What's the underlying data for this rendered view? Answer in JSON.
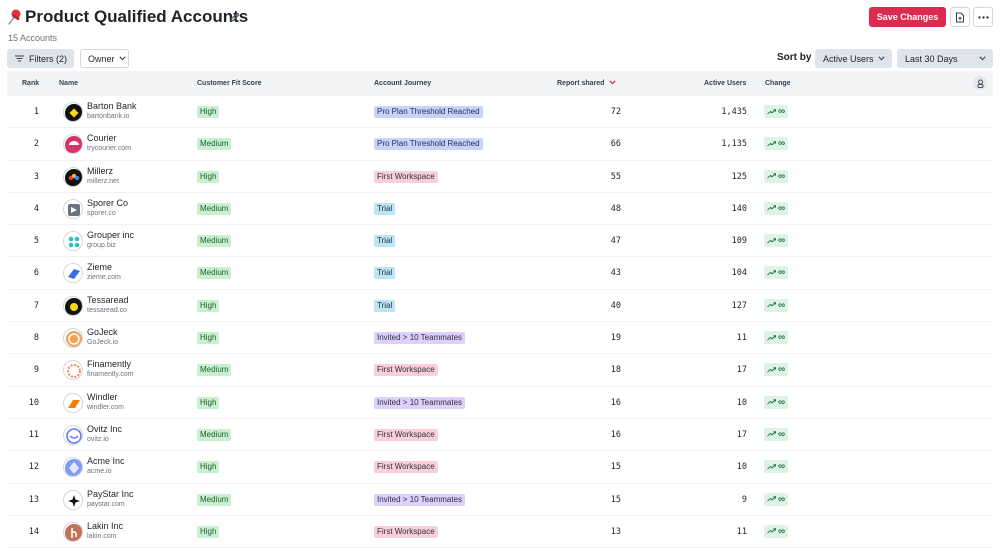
{
  "header": {
    "title": "Product Qualified Accounts",
    "subtitle": "15 Accounts",
    "save_label": "Save Changes"
  },
  "toolbar": {
    "filters_label": "Filters (2)",
    "owner_label": "Owner",
    "sortby_label": "Sort by",
    "sort_field": "Active Users",
    "date_range": "Last 30 Days"
  },
  "table": {
    "columns": [
      "Rank",
      "Name",
      "Customer Fit Score",
      "Account Journey",
      "Report shared",
      "Active Users",
      "Change"
    ],
    "rows": [
      {
        "rank": "1",
        "name": "Barton Bank",
        "domain": "bartonbank.io",
        "fit": "High",
        "journey": "Pro Plan Threshold Reached",
        "reports": "72",
        "active": "1,435",
        "change": "∞"
      },
      {
        "rank": "2",
        "name": "Courier",
        "domain": "trycourier.com",
        "fit": "Medium",
        "journey": "Pro Plan Threshold Reached",
        "reports": "66",
        "active": "1,135",
        "change": "∞"
      },
      {
        "rank": "3",
        "name": "Millerz",
        "domain": "millerz.net",
        "fit": "High",
        "journey": "First Workspace",
        "reports": "55",
        "active": "125",
        "change": "∞"
      },
      {
        "rank": "4",
        "name": "Sporer Co",
        "domain": "sporer.co",
        "fit": "Medium",
        "journey": "Trial",
        "reports": "48",
        "active": "140",
        "change": "∞"
      },
      {
        "rank": "5",
        "name": "Grouper inc",
        "domain": "group.biz",
        "fit": "Medium",
        "journey": "Trial",
        "reports": "47",
        "active": "109",
        "change": "∞"
      },
      {
        "rank": "6",
        "name": "Zieme",
        "domain": "zieme.com",
        "fit": "Medium",
        "journey": "Trial",
        "reports": "43",
        "active": "104",
        "change": "∞"
      },
      {
        "rank": "7",
        "name": "Tessaread",
        "domain": "tessaread.co",
        "fit": "High",
        "journey": "Trial",
        "reports": "40",
        "active": "127",
        "change": "∞"
      },
      {
        "rank": "8",
        "name": "GoJeck",
        "domain": "GoJeck.io",
        "fit": "High",
        "journey": "Invited > 10 Teammates",
        "reports": "19",
        "active": "11",
        "change": "∞"
      },
      {
        "rank": "9",
        "name": "Finamently",
        "domain": "finamently.com",
        "fit": "Medium",
        "journey": "First Workspace",
        "reports": "18",
        "active": "17",
        "change": "∞"
      },
      {
        "rank": "10",
        "name": "Windler",
        "domain": "windler.com",
        "fit": "High",
        "journey": "Invited > 10 Teammates",
        "reports": "16",
        "active": "10",
        "change": "∞"
      },
      {
        "rank": "11",
        "name": "Ovitz Inc",
        "domain": "ovitz.io",
        "fit": "Medium",
        "journey": "First Workspace",
        "reports": "16",
        "active": "17",
        "change": "∞"
      },
      {
        "rank": "12",
        "name": "Acme Inc",
        "domain": "acme.io",
        "fit": "High",
        "journey": "First Workspace",
        "reports": "15",
        "active": "10",
        "change": "∞"
      },
      {
        "rank": "13",
        "name": "PayStar Inc",
        "domain": "paystar.com",
        "fit": "Medium",
        "journey": "Invited > 10 Teammates",
        "reports": "15",
        "active": "9",
        "change": "∞"
      },
      {
        "rank": "14",
        "name": "Lakin Inc",
        "domain": "lakin.com",
        "fit": "High",
        "journey": "First Workspace",
        "reports": "13",
        "active": "11",
        "change": "∞"
      }
    ]
  },
  "colors": {
    "brand_red": "#dc2b4f",
    "fit_tag_bg": "#c8efcf",
    "change_bg": "#dff3e4",
    "journey_pro_bg": "#c7d2fe",
    "journey_first_bg": "#fbcfd8",
    "journey_trial_bg": "#bae6f2",
    "journey_invited_bg": "#ddd0fb"
  },
  "icons": {
    "pin": "pushpin-icon",
    "edit": "pencil-icon",
    "export": "file-export-icon",
    "more": "more-horizontal-icon",
    "filter": "filter-lines-icon",
    "chevron": "chevron-down-icon",
    "sort_arrow": "sort-desc-arrow-icon",
    "trend": "trend-up-icon",
    "settings": "column-settings-icon"
  }
}
